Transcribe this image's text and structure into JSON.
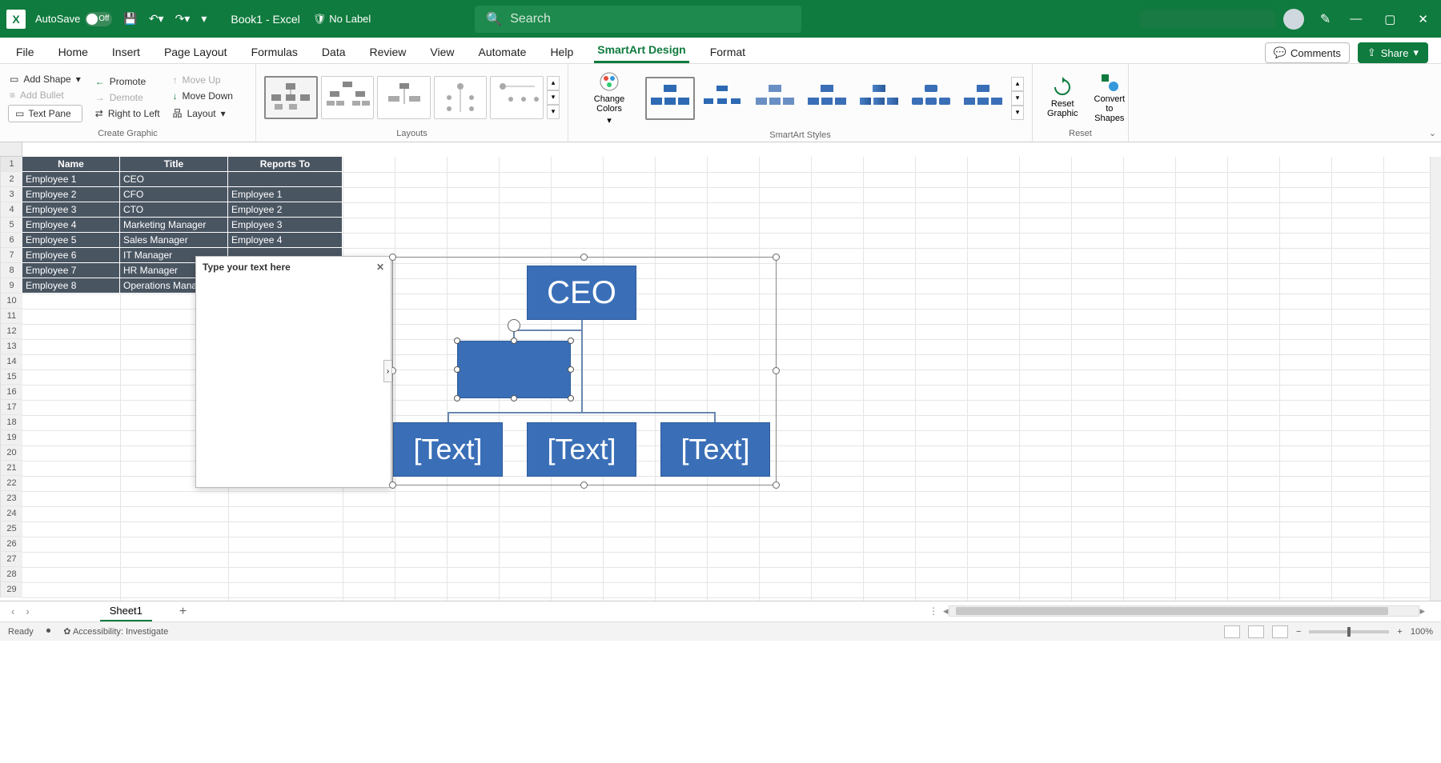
{
  "titlebar": {
    "autosave_label": "AutoSave",
    "autosave_state": "Off",
    "doc_title": "Book1  -  Excel",
    "no_label": "No Label",
    "search_placeholder": "Search"
  },
  "tabs": {
    "file": "File",
    "home": "Home",
    "insert": "Insert",
    "page_layout": "Page Layout",
    "formulas": "Formulas",
    "data": "Data",
    "review": "Review",
    "view": "View",
    "automate": "Automate",
    "help": "Help",
    "smartart_design": "SmartArt Design",
    "format": "Format",
    "comments": "Comments",
    "share": "Share"
  },
  "ribbon": {
    "add_shape": "Add Shape",
    "add_bullet": "Add Bullet",
    "text_pane": "Text Pane",
    "promote": "Promote",
    "demote": "Demote",
    "right_to_left": "Right to Left",
    "move_up": "Move Up",
    "move_down": "Move Down",
    "layout": "Layout",
    "group_create": "Create Graphic",
    "group_layouts": "Layouts",
    "change_colors": "Change Colors",
    "group_styles": "SmartArt Styles",
    "reset_graphic": "Reset Graphic",
    "convert_shapes": "Convert to Shapes",
    "group_reset": "Reset"
  },
  "table": {
    "headers": [
      "Name",
      "Title",
      "Reports To"
    ],
    "rows": [
      [
        "Employee 1",
        "CEO",
        ""
      ],
      [
        "Employee 2",
        "CFO",
        "Employee 1"
      ],
      [
        "Employee 3",
        "CTO",
        "Employee 2"
      ],
      [
        "Employee 4",
        "Marketing Manager",
        "Employee 3"
      ],
      [
        "Employee 5",
        "Sales Manager",
        "Employee 4"
      ],
      [
        "Employee 6",
        "IT Manager",
        ""
      ],
      [
        "Employee 7",
        "HR Manager",
        ""
      ],
      [
        "Employee 8",
        "Operations Manager",
        ""
      ]
    ]
  },
  "smartart": {
    "ceo": "CEO",
    "placeholder": "[Text]"
  },
  "textpane": {
    "prompt": "Type your text here"
  },
  "sheet_tabs": {
    "sheet1": "Sheet1"
  },
  "statusbar": {
    "ready": "Ready",
    "accessibility": "Accessibility: Investigate",
    "zoom": "100%"
  },
  "colors": {
    "accent": "#0f7b3e",
    "smartart_fill": "#3a6fb7",
    "table_fill": "#4a5562"
  }
}
